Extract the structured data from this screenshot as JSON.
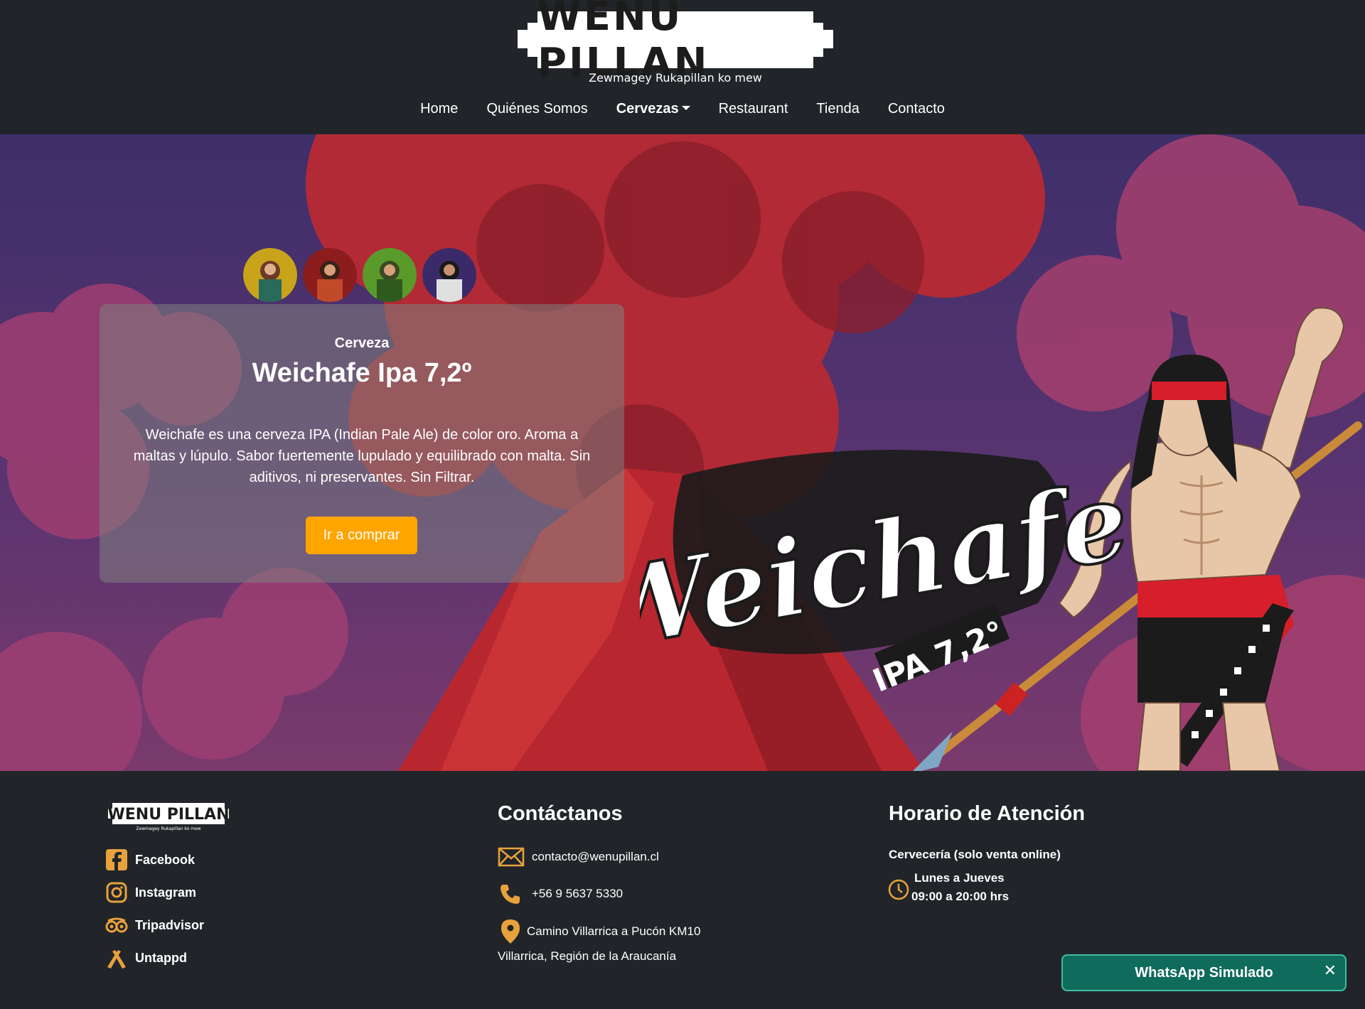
{
  "header": {
    "logo_text": "WENU PILLAN",
    "tagline": "Zewmagey Rukapillan ko mew",
    "nav": [
      {
        "label": "Home"
      },
      {
        "label": "Quiénes Somos"
      },
      {
        "label": "Cervezas"
      },
      {
        "label": "Restaurant"
      },
      {
        "label": "Tienda"
      },
      {
        "label": "Contacto"
      }
    ]
  },
  "hero": {
    "kicker": "Cerveza",
    "title": "Weichafe Ipa 7,2º",
    "description": "Weichafe es una cerveza IPA (Indian Pale Ale) de color oro. Aroma a maltas y lúpulo. Sabor fuertemente lupulado y equilibrado con malta. Sin aditivos, ni preservantes. Sin Filtrar.",
    "cta": "Ir a comprar",
    "label_script": "Weichafe",
    "label_sub": "IPA 7,2°",
    "thumbnails": [
      "yellow",
      "red",
      "green",
      "purple"
    ]
  },
  "footer": {
    "logo_text": "WENU PILLAN",
    "logo_tagline": "Zewmagey Rukapillan ko mew",
    "social": [
      {
        "label": "Facebook",
        "icon": "facebook-icon"
      },
      {
        "label": "Instagram",
        "icon": "instagram-icon"
      },
      {
        "label": "Tripadvisor",
        "icon": "tripadvisor-icon"
      },
      {
        "label": "Untappd",
        "icon": "untappd-icon"
      }
    ],
    "contact": {
      "title": "Contáctanos",
      "email": "contacto@wenupillan.cl",
      "phone": "+56 9 5637 5330",
      "address_line1": "Camino Villarrica a Pucón KM10",
      "address_line2": "Villarrica, Región de la Araucanía"
    },
    "hours": {
      "title": "Horario de Atención",
      "subtitle": "Cervecería (solo venta online)",
      "days": "Lunes a Jueves",
      "time": "09:00 a 20:00 hrs"
    }
  },
  "whatsapp": {
    "label": "WhatsApp Simulado",
    "close": "✕"
  },
  "colors": {
    "accent": "#ffa500",
    "icon": "#e8a23c",
    "dark": "#212529"
  }
}
